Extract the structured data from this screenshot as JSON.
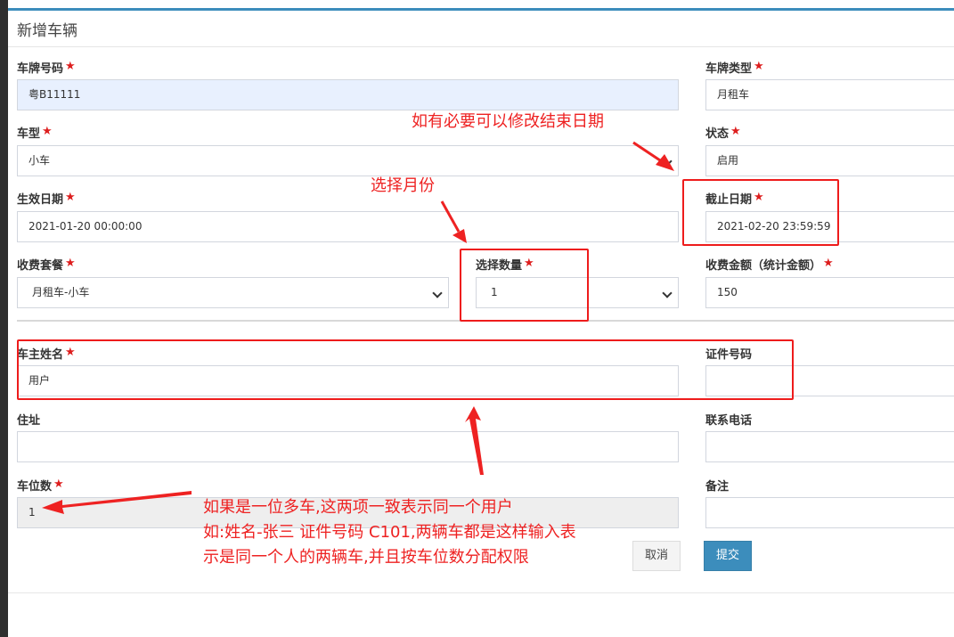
{
  "page": {
    "title": "新增车辆"
  },
  "form": {
    "plate_no": {
      "label": "车牌号码",
      "value": "粤B11111"
    },
    "plate_type": {
      "label": "车牌类型",
      "value": "月租车"
    },
    "car_type": {
      "label": "车型",
      "value": "小车"
    },
    "status": {
      "label": "状态",
      "value": "启用"
    },
    "start_date": {
      "label": "生效日期",
      "value": "2021-01-20 00:00:00"
    },
    "end_date": {
      "label": "截止日期",
      "value": "2021-02-20 23:59:59"
    },
    "package": {
      "label": "收费套餐",
      "value": "月租车-小车"
    },
    "quantity": {
      "label": "选择数量",
      "value": "1"
    },
    "amount": {
      "label": "收费金额（统计金额）",
      "value": "150"
    },
    "owner_name": {
      "label": "车主姓名",
      "value": "用户"
    },
    "id_no": {
      "label": "证件号码",
      "value": ""
    },
    "address": {
      "label": "住址",
      "value": ""
    },
    "phone": {
      "label": "联系电话",
      "value": ""
    },
    "spaces": {
      "label": "车位数",
      "value": "1"
    },
    "remark": {
      "label": "备注",
      "value": ""
    },
    "required_mark": "★"
  },
  "buttons": {
    "cancel": "取消",
    "submit": "提交"
  },
  "annotations": {
    "end_date_note": "如有必要可以修改结束日期",
    "month_note": "选择月份",
    "owner_note_line1": "如果是一位多车,这两项一致表示同一个用户",
    "owner_note_line2": "如:姓名-张三  证件号码 C101,两辆车都是这样输入表",
    "owner_note_line3": "示是同一个人的两辆车,并且按车位数分配权限"
  },
  "colors": {
    "accent": "#3c8dbc",
    "annotation": "#ee2222",
    "required": "#dd1e1e"
  }
}
